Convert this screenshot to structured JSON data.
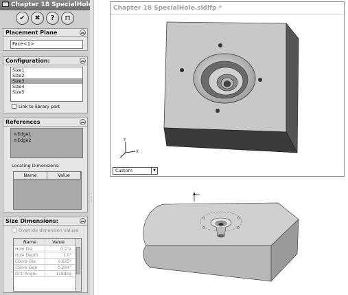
{
  "property_manager": {
    "title": "Chapter 18 SpecialHole",
    "buttons": [
      {
        "name": "ok-button",
        "glyph": "✔"
      },
      {
        "name": "cancel-button",
        "glyph": "✖"
      },
      {
        "name": "help-button",
        "glyph": "?"
      },
      {
        "name": "pushpin-button",
        "glyph": "⊓"
      }
    ],
    "placement_plane": {
      "header": "Placement Plane",
      "value": "Face<1>"
    },
    "configuration": {
      "header": "Configuration:",
      "items": [
        "Size1",
        "Size2",
        "Size3",
        "Size4",
        "Size5"
      ],
      "selected_index": 2,
      "link_label": "Link to library part"
    },
    "references": {
      "header": "References",
      "items": [
        "Edge1",
        "Edge2"
      ],
      "locating_label": "Locating Dimensions:",
      "columns": [
        "Name",
        "Value"
      ]
    },
    "size_dimensions": {
      "header": "Size Dimensions:",
      "override_label": "Override dimension values",
      "columns": [
        "Name",
        "Value"
      ],
      "rows": [
        [
          "Hole Dia",
          "0.2\"e"
        ],
        [
          "Hole Depth",
          "1.0\""
        ],
        [
          "CBore Dia",
          "1.625\""
        ],
        [
          "CBore Dep",
          "0.264\""
        ],
        [
          "Drill Angle",
          "118deg"
        ]
      ]
    }
  },
  "graphics_window": {
    "title": "Chapter 18 SpecialHole.sldlfp *",
    "view_combo": "Custom"
  },
  "colors": {
    "panel_bg": "#cfcfcf",
    "title_bar": "#7a7a7a",
    "selection": "#a8a8a8"
  }
}
